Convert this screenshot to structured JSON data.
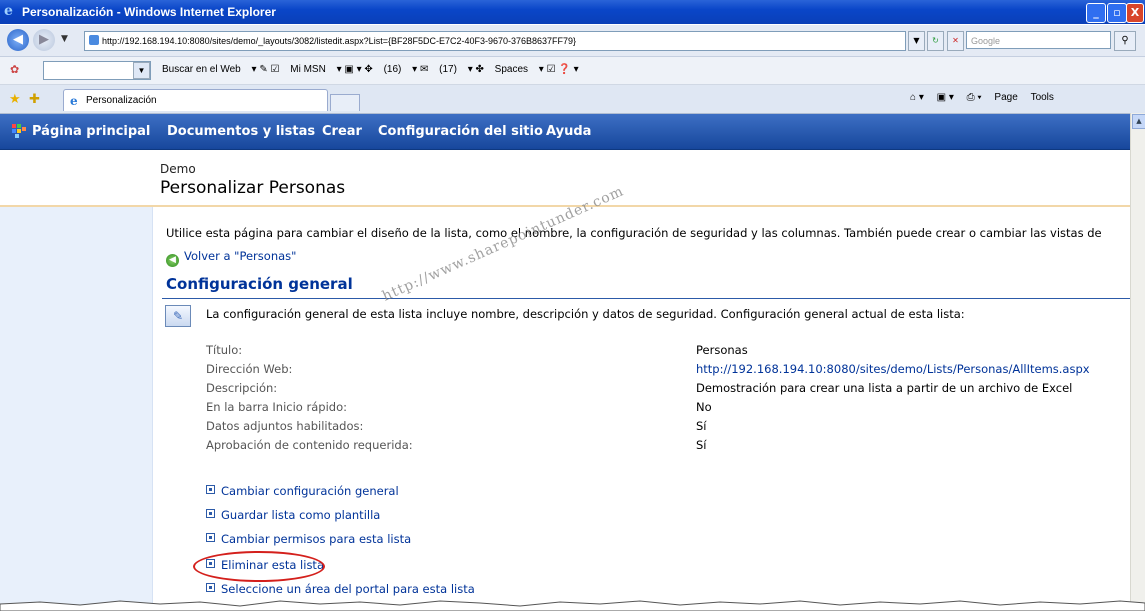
{
  "window": {
    "title": "Personalización - Windows Internet Explorer",
    "buttons": [
      "_",
      "▫",
      "X"
    ]
  },
  "address_bar": {
    "url": "http://192.168.194.10:8080/sites/demo/_layouts/3082/listedit.aspx?List={BF28F5DC-E7C2-40F3-9670-376B8637FF79}",
    "search_placeholder": "Google"
  },
  "toolbar": {
    "search_web": "Buscar en el Web",
    "msn": "Mi MSN",
    "feeds_count": "(16)",
    "mail_count": "(17)",
    "spaces": "Spaces"
  },
  "tabs": {
    "active_tab": "Personalización",
    "page_menu": "Page",
    "tools_menu": "Tools"
  },
  "sp_nav": {
    "items": [
      "Página principal",
      "Documentos y listas",
      "Crear",
      "Configuración del sitio",
      "Ayuda"
    ]
  },
  "header": {
    "site_name": "Demo",
    "page_title": "Personalizar Personas"
  },
  "main": {
    "description": "Utilice esta página para cambiar el diseño de la lista, como el nombre, la configuración de seguridad y las columnas. También puede crear o cambiar las vistas de",
    "back_link": "Volver a \"Personas\"",
    "section_title": "Configuración general",
    "section_desc": "La configuración general de esta lista incluye nombre, descripción y datos de seguridad. Configuración general actual de esta lista:",
    "properties": [
      {
        "label": "Título:",
        "value": "Personas"
      },
      {
        "label": "Dirección Web:",
        "value": "http://192.168.194.10:8080/sites/demo/Lists/Personas/AllItems.aspx"
      },
      {
        "label": "Descripción:",
        "value": "Demostración para crear una lista a partir de un archivo de Excel"
      },
      {
        "label": "En la barra Inicio rápido:",
        "value": "No"
      },
      {
        "label": "Datos adjuntos habilitados:",
        "value": "Sí"
      },
      {
        "label": "Aprobación de contenido requerida:",
        "value": "Sí"
      }
    ],
    "actions": [
      "Cambiar configuración general",
      "Guardar lista como plantilla",
      "Cambiar permisos para esta lista",
      "Eliminar esta lista",
      "Seleccione un área del portal para esta lista"
    ]
  },
  "watermark": "http://www.sharepointunder.com"
}
